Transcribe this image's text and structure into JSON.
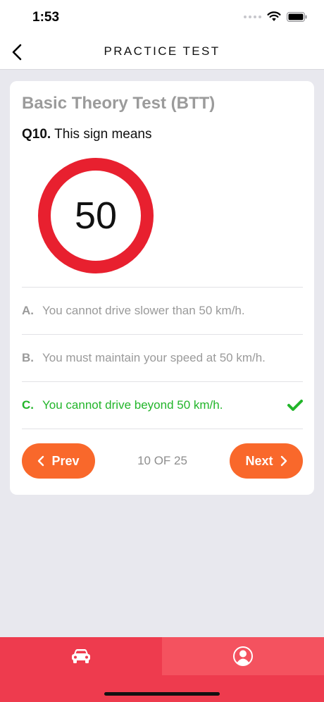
{
  "status_bar": {
    "time": "1:53"
  },
  "nav": {
    "title": "PRACTICE TEST"
  },
  "card": {
    "test_title": "Basic Theory Test (BTT)",
    "question_number": "Q10.",
    "question_text": "This sign means",
    "sign_value": "50",
    "options": [
      {
        "letter": "A.",
        "text": "You cannot drive slower than 50 km/h.",
        "state": "normal"
      },
      {
        "letter": "B.",
        "text": "You must maintain your speed at 50 km/h.",
        "state": "normal"
      },
      {
        "letter": "C.",
        "text": "You cannot drive beyond 50 km/h.",
        "state": "correct"
      }
    ],
    "prev_label": "Prev",
    "next_label": "Next",
    "progress": "10 OF 25"
  },
  "colors": {
    "accent": "#f9682b",
    "correct": "#22b52a",
    "tab_bar": "#ee3b4e",
    "tab_active": "#f4525f",
    "sign_ring": "#e8202f"
  },
  "tab_bar": {
    "tabs": [
      {
        "icon": "car-icon"
      },
      {
        "icon": "profile-icon"
      }
    ]
  }
}
